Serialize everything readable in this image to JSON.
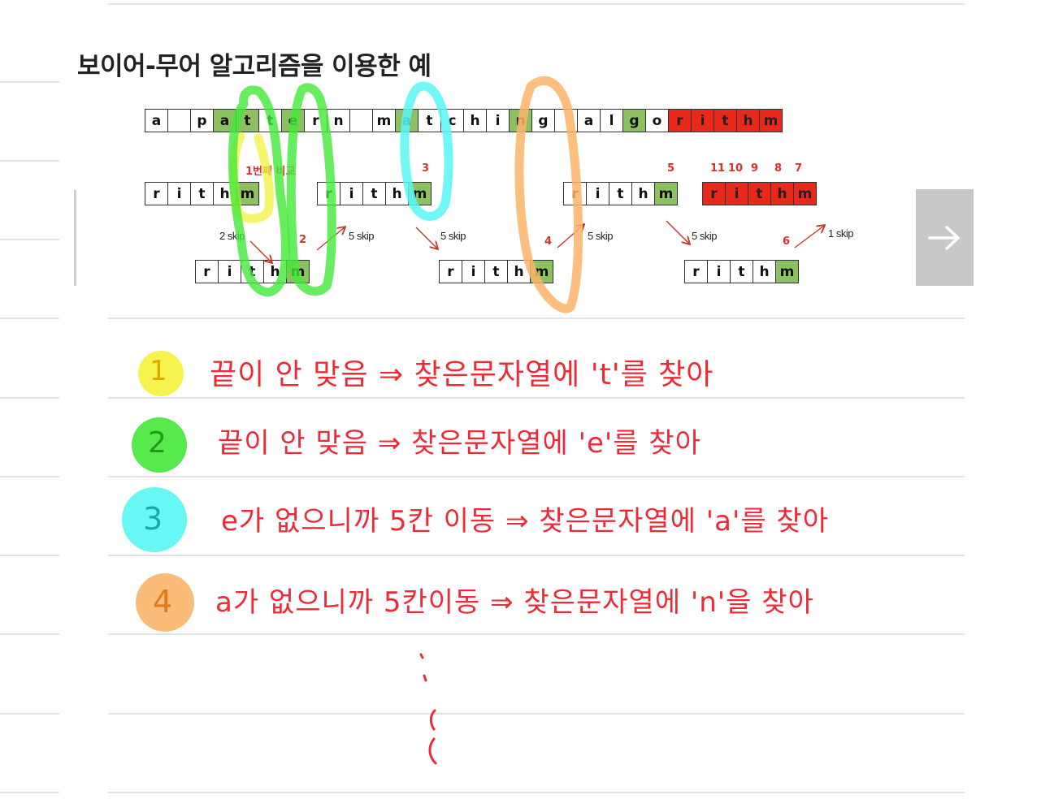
{
  "title": "보이어-무어 알고리즘을 이용한 예",
  "text_row": [
    "a",
    "",
    "p",
    "a",
    "t",
    "t",
    "e",
    "r",
    "n",
    "",
    "m",
    "a",
    "t",
    "c",
    "h",
    "i",
    "n",
    "g",
    "",
    "a",
    "l",
    "g",
    "o",
    "r",
    "i",
    "t",
    "h",
    "m"
  ],
  "pattern": [
    "r",
    "i",
    "t",
    "h",
    "m"
  ],
  "colors": {
    "match": "#8dc060",
    "mismatch_red": "#e8281b",
    "annotation": "#ee2a37",
    "label_red": "#d7322d",
    "hl_yellow": "#f4f23c",
    "hl_green": "#44e838",
    "hl_cyan": "#58f6f4",
    "hl_orange": "#fbb46a"
  },
  "labels": {
    "first": "1번째 비교",
    "n2": "2",
    "n3": "3",
    "n4": "4",
    "n5": "5",
    "n6": "6",
    "n11": "11",
    "n10": "10",
    "n9": "9",
    "n8": "8",
    "n7": "7"
  },
  "skips": {
    "s1": "2 skip",
    "s2": "5 skip",
    "s3": "5 skip",
    "s4": "5 skip",
    "s5": "5 skip",
    "s6": "1 skip"
  },
  "next_button": {
    "icon": "arrow-right-icon"
  },
  "notes": [
    {
      "num": "1",
      "text": "끝이 안 맞음 ⇒ 찾은문자열에 't'를 찾아"
    },
    {
      "num": "2",
      "text": "끝이 안 맞음 ⇒ 찾은문자열에 'e'를 찾아"
    },
    {
      "num": "3",
      "text": "e가 없으니까 5칸 이동 ⇒ 찾은문자열에 'a'를 찾아"
    },
    {
      "num": "4",
      "text": "a가 없으니까 5칸이동 ⇒ 찾은문자열에 'n'을 찾아"
    }
  ]
}
